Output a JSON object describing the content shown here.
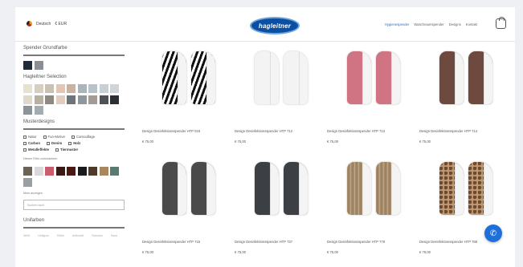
{
  "header": {
    "language": "Deutsch",
    "currency": "€ EUR",
    "logo_text": "hagleitner",
    "nav": [
      "Hygienespender",
      "Waschraumspender",
      "Designs",
      "Kontakt"
    ],
    "active_nav_index": 0
  },
  "sidebar": {
    "section1_title": "Spender Grundfarbe",
    "section2_title": "Hagleitner Selection",
    "section3_title": "Musterdesigns",
    "section4_title": "Unifarben",
    "base_colors": [
      "#1f2b3a",
      "#8a8f96"
    ],
    "selection_colors": [
      "#e9e1cf",
      "#d6cfbf",
      "#c9c1b4",
      "#e3c7b4",
      "#c9b29f",
      "#a8b5bd",
      "#b6c3c9",
      "#c7d1d5",
      "#cfd5d8",
      "#e0d8c8",
      "#b9b0a1",
      "#8e8a82",
      "#e2ccbb",
      "#6e747b",
      "#8e979e",
      "#a49c92",
      "#4c5256",
      "#2b2f34",
      "#8c949a",
      "#a3acb1"
    ],
    "filter_row1": [
      "Natur",
      "Fun-Motive",
      "Camouflage"
    ],
    "filter_row2": [
      "Carbon",
      "Denim",
      "Holz"
    ],
    "filter_row3": [
      "Metalleffekte",
      "Tiermuster"
    ],
    "reset_filters": "Diesen Filter zurücksetzen",
    "pattern_colors": [
      "#6b6454",
      "#d9d9d9",
      "#c85d6d",
      "#3a1a14",
      "#4a1a12",
      "#1a1a1a",
      "#4d3a2a",
      "#a8875f",
      "#587a70",
      "#9aa0a2"
    ],
    "more_link": "Mehr anzeigen",
    "search_placeholder": "Suchen nach",
    "unicolor_options": [
      "Weiß",
      "Hellgrau",
      "Silber",
      "Anthrazit",
      "Schwarz",
      "Sand"
    ]
  },
  "products": [
    {
      "name": "Design Desinfektionsspender HTP 018",
      "price": "€ 75,00",
      "color": "#ffffff",
      "pattern": "zebra"
    },
    {
      "name": "Design Desinfektionsspender HTP 712",
      "price": "€ 75,00",
      "color": "#f3f3f3",
      "pattern": "plain"
    },
    {
      "name": "Design Desinfektionsspender HTP 713",
      "price": "€ 75,00",
      "color": "#d07483",
      "pattern": "plain"
    },
    {
      "name": "Design Desinfektionsspender HTP 714",
      "price": "€ 75,00",
      "color": "#6e4a3e",
      "pattern": "plain"
    },
    {
      "name": "Design Desinfektionsspender HTP 715",
      "price": "€ 75,00",
      "color": "#4a4a4a",
      "pattern": "plain"
    },
    {
      "name": "Design Desinfektionsspender HTP 737",
      "price": "€ 75,00",
      "color": "#3c4045",
      "pattern": "plain"
    },
    {
      "name": "Design Desinfektionsspender HTP 778",
      "price": "€ 75,00",
      "color": "#a58b6a",
      "pattern": "wood"
    },
    {
      "name": "Design Desinfektionsspender HTP 788",
      "price": "€ 75,00",
      "color": "#c29a72",
      "pattern": "snake"
    }
  ],
  "chat_button": "phone-icon"
}
